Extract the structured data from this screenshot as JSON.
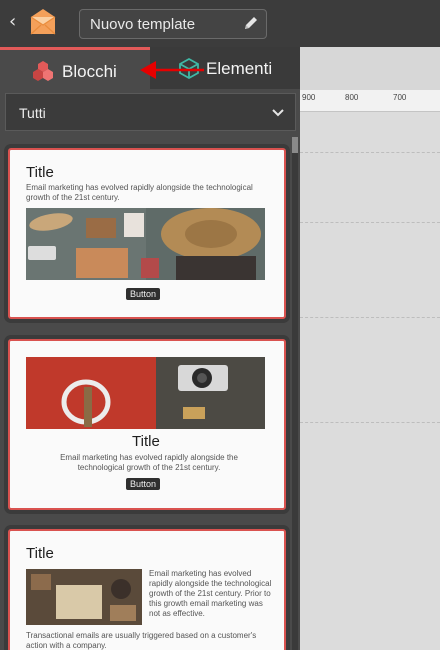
{
  "header": {
    "back_icon": "chevron-left-icon",
    "logo_icon": "envelope-logo-icon",
    "template_name": "Nuovo template",
    "edit_icon": "pencil-icon"
  },
  "tabs": {
    "blocchi": {
      "label": "Blocchi",
      "icon": "blocks-icon",
      "active": true
    },
    "elementi": {
      "label": "Elementi",
      "icon": "cube-icon"
    }
  },
  "filter": {
    "value": "Tutti",
    "icon": "chevron-down-icon"
  },
  "ruler": {
    "ticks": [
      "900",
      "800",
      "700"
    ]
  },
  "cards": [
    {
      "title": "Title",
      "text": "Email marketing has evolved rapidly alongside the technological growth of the 21st century.",
      "button": "Button"
    },
    {
      "title": "Title",
      "text": "Email marketing has evolved rapidly alongside the technological growth of the 21st century.",
      "button": "Button"
    },
    {
      "title": "Title",
      "side_text": "Email marketing has evolved rapidly alongside the technological growth of the 21st century. Prior to this growth email marketing was not as effective.",
      "bottom_text": "Transactional emails are usually triggered based on a customer's action with a company."
    }
  ],
  "colors": {
    "accent": "#e25a59",
    "topbar": "#3c3c3c",
    "panel": "#4a4a4a",
    "canvas": "#d7d7d7",
    "elementi_icon": "#3fb8a6"
  }
}
